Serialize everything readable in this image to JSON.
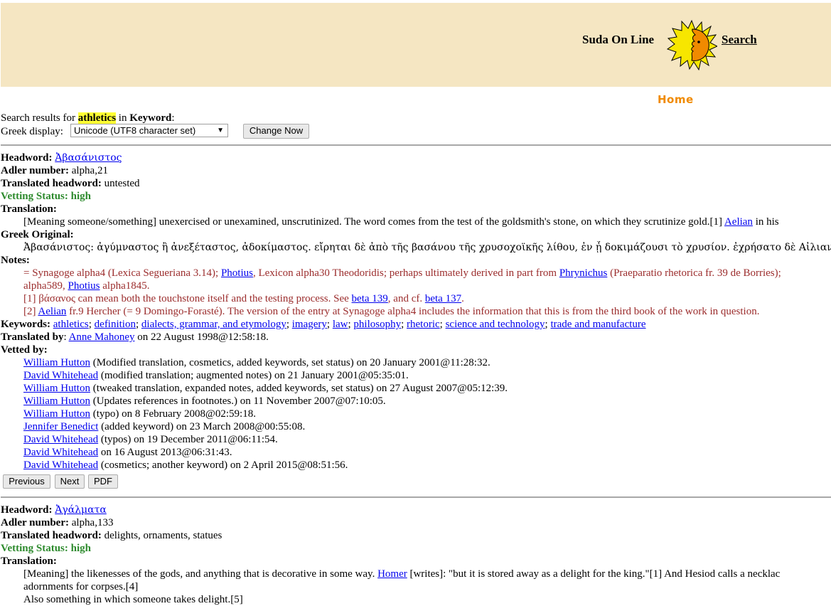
{
  "header": {
    "site_name": "Suda On Line",
    "search_link": "Search",
    "home_link": "Home",
    "accent_color": "#f08a00",
    "banner_color": "#f5e6c2"
  },
  "search": {
    "prefix": "Search results for ",
    "term": "athletics",
    "middle": " in ",
    "field": "Keyword",
    "suffix": ":",
    "display_label": "Greek display: ",
    "display_value": "Unicode (UTF8 character set)",
    "change_button": "Change Now"
  },
  "entry1": {
    "headword_label": "Headword:",
    "headword": "Ἀβασάνιστος",
    "adler_label": "Adler number:",
    "adler": " alpha,21",
    "translated_label": "Translated headword:",
    "translated": " untested",
    "vetting": "Vetting Status: high",
    "translation_label": "Translation:",
    "translation_a": "[Meaning someone/something] unexercised or unexamined, unscrutinized. The word comes from the test of the goldsmith's stone, on which they scrutinize gold.[1] ",
    "translation_link": "Aelian",
    "translation_b": " in his",
    "greek_label": "Greek Original:",
    "greek": "Ἀβασάνιστος: ἀγύμναστος ἢ ἀνεξέταστος, ἀδοκίμαστος. εἴρηται δὲ ἀπὸ τῆς βασάνου τῆς χρυσοχοϊκῆς λίθου, ἐν ᾗ δοκιμάζουσι τὸ χρυσίον. ἐχρήσατο δὲ Αἰλιανὸς ἐν τῷ περὶ προ",
    "notes_label": "Notes:",
    "note1_a": "= Synagoge alpha4 (Lexica Segueriana 3.14); ",
    "note1_link1": "Photius",
    "note1_b": ", Lexicon alpha30 Theodoridis; perhaps ultimately derived in part from ",
    "note1_link2": "Phrynichus",
    "note1_c": " (Praeparatio rhetorica fr. 39 de Borries);",
    "note1_d": "alpha589, ",
    "note1_link3": "Photius",
    "note1_e": " alpha1845.",
    "note2_a": "[1] βάσανος can mean both the touchstone itself and the testing process. See ",
    "note2_link1": "beta 139",
    "note2_b": ", and cf. ",
    "note2_link2": "beta 137",
    "note2_c": ".",
    "note3_a": "[2] ",
    "note3_link": "Aelian",
    "note3_b": " fr.9 Hercher (= 9 Domingo-Forasté). The version of the entry at Synagoge alpha4 includes the information that this is from the third book of the work in question.",
    "keywords_label": "Keywords:",
    "keywords": [
      "athletics",
      "definition",
      "dialects, grammar, and etymology",
      "imagery",
      "law",
      "philosophy",
      "rhetoric",
      "science and technology",
      "trade and manufacture"
    ],
    "translated_by_label": "Translated by",
    "translated_by_colon": ": ",
    "translator": "Anne Mahoney",
    "translated_on": " on 22 August 1998@12:58:18.",
    "vetted_label": "Vetted by:",
    "vetted": [
      {
        "name": "William Hutton",
        "text": " (Modified translation, cosmetics, added keywords, set status) on 20 January 2001@11:28:32."
      },
      {
        "name": "David Whitehead",
        "text": " (modified translation; augmented notes) on 21 January 2001@05:35:01."
      },
      {
        "name": "William Hutton",
        "text": " (tweaked translation, expanded notes, added keywords, set status) on 27 August 2007@05:12:39."
      },
      {
        "name": "William Hutton",
        "text": " (Updates references in footnotes.) on 11 November 2007@07:10:05."
      },
      {
        "name": "William Hutton",
        "text": " (typo) on 8 February 2008@02:59:18."
      },
      {
        "name": "Jennifer Benedict",
        "text": " (added keyword) on 23 March 2008@00:55:08."
      },
      {
        "name": "David Whitehead",
        "text": " (typos) on 19 December 2011@06:11:54."
      },
      {
        "name": "David Whitehead",
        "text": " on 16 August 2013@06:31:43."
      },
      {
        "name": "David Whitehead",
        "text": " (cosmetics; another keyword) on 2 April 2015@08:51:56."
      }
    ],
    "buttons": {
      "previous": "Previous",
      "next": "Next",
      "pdf": "PDF"
    }
  },
  "entry2": {
    "headword_label": "Headword:",
    "headword": "Ἀγάλματα",
    "adler_label": "Adler number:",
    "adler": " alpha,133",
    "translated_label": "Translated headword:",
    "translated": " delights, ornaments, statues",
    "vetting": "Vetting Status: high",
    "translation_label": "Translation:",
    "translation_a": "[Meaning] the likenesses of the gods, and anything that is decorative in some way. ",
    "translation_link": "Homer",
    "translation_b": " [writes]: \"but it is stored away as a delight for the king.\"[1] And Hesiod calls a necklac",
    "translation_line2": "adornments for corpses.[4]",
    "translation_line3": "Also something in which someone takes delight.[5]"
  }
}
